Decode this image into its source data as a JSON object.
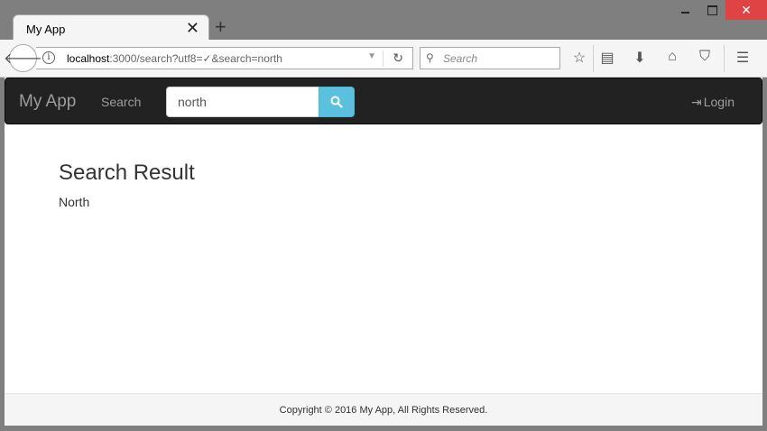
{
  "window": {
    "minimize_icon": "minimize-icon",
    "maximize_icon": "maximize-icon",
    "close_symbol": "✕"
  },
  "tab": {
    "title": "My App",
    "close_symbol": "✕",
    "new_tab_symbol": "+"
  },
  "toolbar": {
    "url_host": "localhost",
    "url_rest": ":3000/search?utf8=✓&search=north",
    "search_placeholder": "Search",
    "info_symbol": "i"
  },
  "app": {
    "brand": "My App",
    "nav_search": "Search",
    "search_value": "north",
    "login_label": "Login"
  },
  "content": {
    "title": "Search Result",
    "results": [
      "North"
    ]
  },
  "footer": {
    "text": "Copyright © 2016 My App, All Rights Reserved."
  },
  "colors": {
    "navbar": "#222222",
    "search_button": "#5bc0de",
    "close_button": "#e04343"
  }
}
